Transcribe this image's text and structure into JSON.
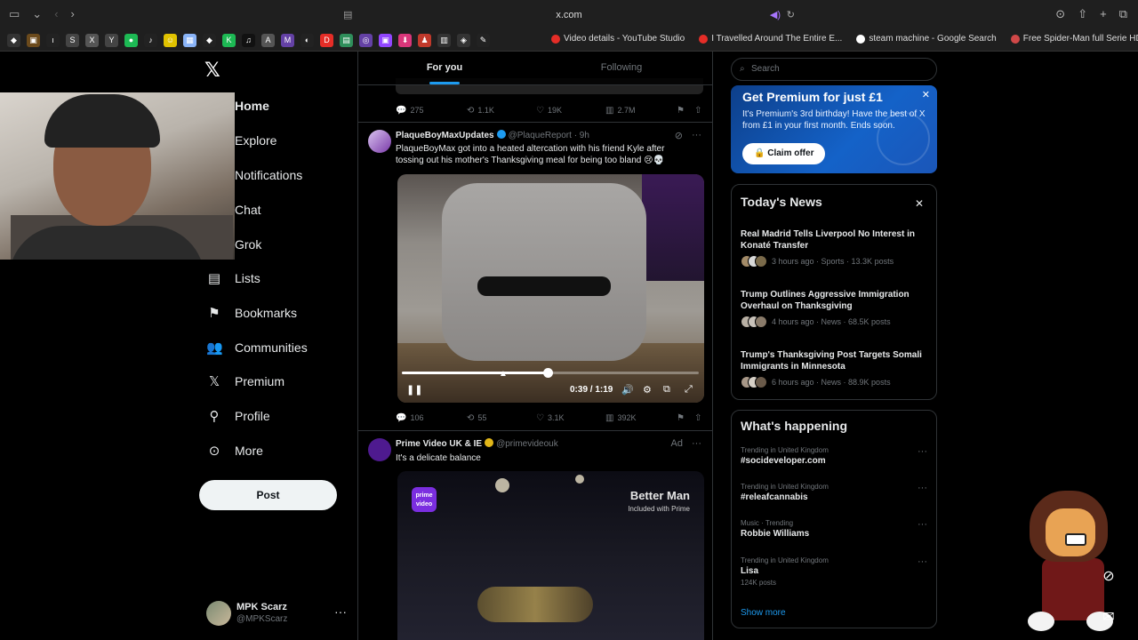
{
  "browser": {
    "url": "x.com",
    "bookmark_tabs": [
      {
        "label": "Video details - YouTube Studio",
        "color": "#e52d27"
      },
      {
        "label": "I Travelled Around The Entire E...",
        "color": "#e52d27"
      },
      {
        "label": "steam machine - Google Search",
        "color": "#ffffff"
      },
      {
        "label": "Free Spider-Man full Serie HD...",
        "color": "#d04848"
      }
    ]
  },
  "nav": {
    "items": [
      {
        "label": "Home",
        "icon": "home-icon"
      },
      {
        "label": "Explore",
        "icon": "search-icon"
      },
      {
        "label": "Notifications",
        "icon": "bell-icon"
      },
      {
        "label": "Chat",
        "icon": "chat-icon"
      },
      {
        "label": "Grok",
        "icon": "grok-icon"
      },
      {
        "label": "Lists",
        "icon": "list-icon"
      },
      {
        "label": "Bookmarks",
        "icon": "bookmark-icon"
      },
      {
        "label": "Communities",
        "icon": "communities-icon"
      },
      {
        "label": "Premium",
        "icon": "x-icon"
      },
      {
        "label": "Profile",
        "icon": "person-icon"
      },
      {
        "label": "More",
        "icon": "more-circle-icon"
      }
    ],
    "post_label": "Post",
    "account": {
      "name": "MPK Scarz",
      "handle": "@MPKScarz"
    }
  },
  "feed": {
    "tabs": [
      {
        "label": "For you"
      },
      {
        "label": "Following"
      }
    ],
    "prev_actions": {
      "replies": "275",
      "reposts": "1.1K",
      "likes": "19K",
      "views": "2.7M"
    },
    "tweet1": {
      "name": "PlaqueBoyMaxUpdates",
      "handle": "@PlaqueReport",
      "time": "· 9h",
      "text": "PlaqueBoyMax got into a heated altercation with his friend Kyle after tossing out his mother's Thanksgiving meal for being too bland 😢💀",
      "video_time": "0:39 / 1:19",
      "progress": 0.49,
      "actions": {
        "replies": "106",
        "reposts": "55",
        "likes": "3.1K",
        "views": "392K"
      }
    },
    "tweet2": {
      "name": "Prime Video UK & IE",
      "handle": "@primevideouk",
      "ad_label": "Ad",
      "text": "It's a delicate balance",
      "video_title": "Better Man",
      "video_sub": "Included with Prime",
      "logo_text": "prime video"
    }
  },
  "sidebar": {
    "search_placeholder": "Search",
    "premium": {
      "title": "Get Premium for just £1",
      "body": "It's Premium's 3rd birthday! Have the best of X from £1 in your first month. Ends soon.",
      "cta": "Claim offer"
    },
    "news": {
      "title": "Today's News",
      "items": [
        {
          "headline": "Real Madrid Tells Liverpool No Interest in Konaté Transfer",
          "meta": "3 hours ago · Sports · 13.3K posts"
        },
        {
          "headline": "Trump Outlines Aggressive Immigration Overhaul on Thanksgiving",
          "meta": "4 hours ago · News · 68.5K posts"
        },
        {
          "headline": "Trump's Thanksgiving Post Targets Somali Immigrants in Minnesota",
          "meta": "6 hours ago · News · 88.9K posts"
        }
      ]
    },
    "happening": {
      "title": "What's happening",
      "trends": [
        {
          "context": "Trending in United Kingdom",
          "topic": "#socideveloper.com",
          "count": ""
        },
        {
          "context": "Trending in United Kingdom",
          "topic": "#releafcannabis",
          "count": ""
        },
        {
          "context": "Music · Trending",
          "topic": "Robbie Williams",
          "count": ""
        },
        {
          "context": "Trending in United Kingdom",
          "topic": "Lisa",
          "count": "124K posts"
        }
      ],
      "show_more": "Show more"
    }
  }
}
